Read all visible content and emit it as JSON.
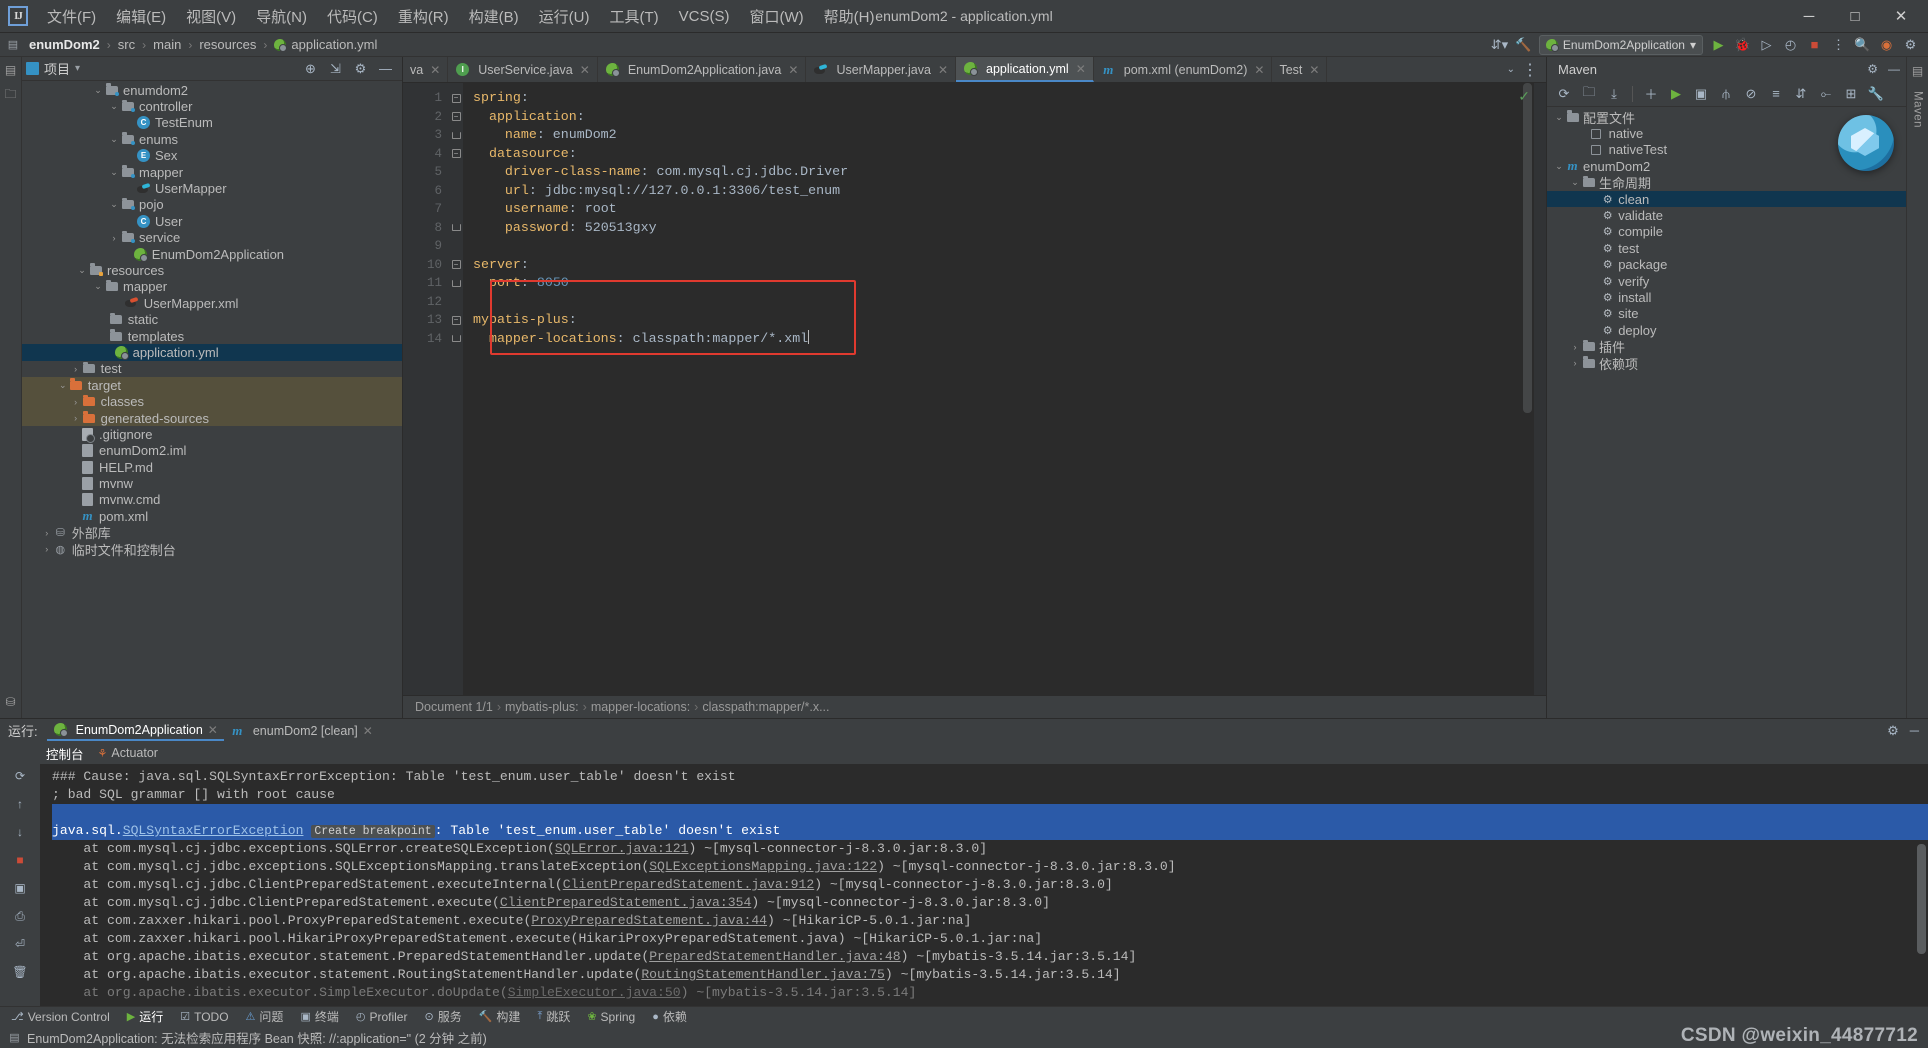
{
  "window": {
    "title": "enumDom2 - application.yml",
    "logo": "IJ",
    "controls": {
      "minimize": "─",
      "maximize": "□",
      "close": "✕"
    }
  },
  "menu": [
    {
      "label": "文件(F)",
      "name": "file"
    },
    {
      "label": "编辑(E)",
      "name": "edit"
    },
    {
      "label": "视图(V)",
      "name": "view"
    },
    {
      "label": "导航(N)",
      "name": "navigate"
    },
    {
      "label": "代码(C)",
      "name": "code"
    },
    {
      "label": "重构(R)",
      "name": "refactor"
    },
    {
      "label": "构建(B)",
      "name": "build"
    },
    {
      "label": "运行(U)",
      "name": "run"
    },
    {
      "label": "工具(T)",
      "name": "tools"
    },
    {
      "label": "VCS(S)",
      "name": "vcs"
    },
    {
      "label": "窗口(W)",
      "name": "window"
    },
    {
      "label": "帮助(H)",
      "name": "help"
    }
  ],
  "breadcrumb": {
    "items": [
      "enumDom2",
      "src",
      "main",
      "resources",
      "application.yml"
    ],
    "separator": "›"
  },
  "run_config": {
    "name": "EnumDom2Application",
    "chevron": "▾"
  },
  "project_panel": {
    "title": "项目",
    "dropdown": "▾",
    "tree": [
      {
        "indent": 4,
        "arrow": "⌄",
        "icon": "folder-src",
        "label": "enumdom2"
      },
      {
        "indent": 5,
        "arrow": "⌄",
        "icon": "folder-src",
        "label": "controller"
      },
      {
        "indent": 6,
        "arrow": "",
        "icon": "class",
        "label": "TestEnum"
      },
      {
        "indent": 5,
        "arrow": "⌄",
        "icon": "folder-src",
        "label": "enums"
      },
      {
        "indent": 6,
        "arrow": "",
        "icon": "enum",
        "label": "Sex"
      },
      {
        "indent": 5,
        "arrow": "⌄",
        "icon": "folder-src",
        "label": "mapper"
      },
      {
        "indent": 6,
        "arrow": "",
        "icon": "mybatis",
        "label": "UserMapper"
      },
      {
        "indent": 5,
        "arrow": "⌄",
        "icon": "folder-src",
        "label": "pojo"
      },
      {
        "indent": 6,
        "arrow": "",
        "icon": "class",
        "label": "User"
      },
      {
        "indent": 5,
        "arrow": "›",
        "icon": "folder-src",
        "label": "service"
      },
      {
        "indent": 5.8,
        "arrow": "",
        "icon": "spring",
        "label": "EnumDom2Application"
      },
      {
        "indent": 3,
        "arrow": "⌄",
        "icon": "folder-res",
        "label": "resources"
      },
      {
        "indent": 4,
        "arrow": "⌄",
        "icon": "folder",
        "label": "mapper"
      },
      {
        "indent": 5.3,
        "arrow": "",
        "icon": "mybatis-red",
        "label": "UserMapper.xml"
      },
      {
        "indent": 4.3,
        "arrow": "",
        "icon": "folder",
        "label": "static"
      },
      {
        "indent": 4.3,
        "arrow": "",
        "icon": "folder",
        "label": "templates"
      },
      {
        "indent": 4.6,
        "arrow": "",
        "icon": "spring",
        "label": "application.yml",
        "state": "selected"
      },
      {
        "indent": 2.6,
        "arrow": "›",
        "icon": "folder",
        "label": "test"
      },
      {
        "indent": 1.8,
        "arrow": "⌄",
        "icon": "folder-orange",
        "label": "target",
        "state": "target"
      },
      {
        "indent": 2.6,
        "arrow": "›",
        "icon": "folder-orange",
        "label": "classes",
        "state": "target"
      },
      {
        "indent": 2.6,
        "arrow": "›",
        "icon": "folder-orange",
        "label": "generated-sources",
        "state": "target"
      },
      {
        "indent": 2.5,
        "arrow": "",
        "icon": "gitignore",
        "label": ".gitignore"
      },
      {
        "indent": 2.5,
        "arrow": "",
        "icon": "file",
        "label": "enumDom2.iml"
      },
      {
        "indent": 2.5,
        "arrow": "",
        "icon": "file",
        "label": "HELP.md"
      },
      {
        "indent": 2.5,
        "arrow": "",
        "icon": "file",
        "label": "mvnw"
      },
      {
        "indent": 2.5,
        "arrow": "",
        "icon": "file",
        "label": "mvnw.cmd"
      },
      {
        "indent": 2.5,
        "arrow": "",
        "icon": "maven",
        "label": "pom.xml"
      },
      {
        "indent": 0.8,
        "arrow": "›",
        "icon": "lib",
        "label": "外部库"
      },
      {
        "indent": 0.8,
        "arrow": "›",
        "icon": "console",
        "label": "临时文件和控制台"
      }
    ]
  },
  "editor": {
    "tabs": [
      {
        "label": "va",
        "icon": "java",
        "active": false,
        "truncated": true
      },
      {
        "label": "UserService.java",
        "icon": "interface",
        "active": false
      },
      {
        "label": "EnumDom2Application.java",
        "icon": "spring",
        "active": false
      },
      {
        "label": "UserMapper.java",
        "icon": "mybatis",
        "active": false
      },
      {
        "label": "application.yml",
        "icon": "spring",
        "active": true
      },
      {
        "label": "pom.xml (enumDom2)",
        "icon": "maven",
        "active": false
      },
      {
        "label": "Test",
        "icon": "class",
        "active": false,
        "truncated": true
      }
    ],
    "tab_overflow": "⌄",
    "tab_more": "⋮",
    "inspection_ok": "✓",
    "line_numbers": [
      1,
      2,
      3,
      4,
      5,
      6,
      7,
      8,
      9,
      10,
      11,
      12,
      13,
      14
    ],
    "lines": [
      {
        "n": 1,
        "indent": 0,
        "key": "spring",
        "colon": ":",
        "value": "",
        "fold": "minus"
      },
      {
        "n": 2,
        "indent": 2,
        "key": "application",
        "colon": ":",
        "value": "",
        "fold": "minus"
      },
      {
        "n": 3,
        "indent": 4,
        "key": "name",
        "colon": ":",
        "value": " enumDom2",
        "fold": "end"
      },
      {
        "n": 4,
        "indent": 2,
        "key": "datasource",
        "colon": ":",
        "value": "",
        "fold": "minus"
      },
      {
        "n": 5,
        "indent": 4,
        "key": "driver-class-name",
        "colon": ":",
        "value": " com.mysql.cj.jdbc.Driver",
        "fold": ""
      },
      {
        "n": 6,
        "indent": 4,
        "key": "url",
        "colon": ":",
        "value": " jdbc:mysql://127.0.0.1:3306/test_enum",
        "fold": ""
      },
      {
        "n": 7,
        "indent": 4,
        "key": "username",
        "colon": ":",
        "value": " root",
        "fold": ""
      },
      {
        "n": 8,
        "indent": 4,
        "key": "password",
        "colon": ":",
        "value": " 520513gxy",
        "fold": "end"
      },
      {
        "n": 9,
        "indent": 0,
        "key": "",
        "colon": "",
        "value": "",
        "fold": ""
      },
      {
        "n": 10,
        "indent": 0,
        "key": "server",
        "colon": ":",
        "value": "",
        "fold": "minus"
      },
      {
        "n": 11,
        "indent": 2,
        "key": "port",
        "colon": ":",
        "value": " 8050",
        "fold": "end"
      },
      {
        "n": 12,
        "indent": 0,
        "key": "",
        "colon": "",
        "value": "",
        "fold": ""
      },
      {
        "n": 13,
        "indent": 0,
        "key": "mybatis-plus",
        "colon": ":",
        "value": "",
        "fold": "minus"
      },
      {
        "n": 14,
        "indent": 2,
        "key": "mapper-locations",
        "colon": ":",
        "value": " classpath:mapper/*.xml",
        "fold": "end",
        "cursor": true
      }
    ],
    "highlight_box": {
      "color": "#e03a2f"
    },
    "status_breadcrumb": {
      "document": "Document 1/1",
      "path": [
        "mybatis-plus:",
        "mapper-locations:",
        "classpath:mapper/*.x..."
      ],
      "separator": "›"
    }
  },
  "maven_panel": {
    "title": "Maven",
    "side_label": "Maven",
    "toolbar": [
      "⟳",
      "὜1",
      "⤓",
      "+",
      "▶",
      "▷",
      "≀",
      "⊘",
      "≡",
      "↓↑",
      "⋮⋮",
      "⌫",
      "⚙"
    ],
    "tree": [
      {
        "indent": 0,
        "arrow": "⌄",
        "icon": "profiles",
        "label": "配置文件"
      },
      {
        "indent": 1.6,
        "arrow": "",
        "icon": "checkbox",
        "label": "native"
      },
      {
        "indent": 1.6,
        "arrow": "",
        "icon": "checkbox",
        "label": "nativeTest"
      },
      {
        "indent": 0,
        "arrow": "⌄",
        "icon": "maven",
        "label": "enumDom2"
      },
      {
        "indent": 1,
        "arrow": "⌄",
        "icon": "lifecycle",
        "label": "生命周期"
      },
      {
        "indent": 2.2,
        "arrow": "",
        "icon": "gear",
        "label": "clean",
        "state": "selected"
      },
      {
        "indent": 2.2,
        "arrow": "",
        "icon": "gear",
        "label": "validate"
      },
      {
        "indent": 2.2,
        "arrow": "",
        "icon": "gear",
        "label": "compile"
      },
      {
        "indent": 2.2,
        "arrow": "",
        "icon": "gear",
        "label": "test"
      },
      {
        "indent": 2.2,
        "arrow": "",
        "icon": "gear",
        "label": "package"
      },
      {
        "indent": 2.2,
        "arrow": "",
        "icon": "gear",
        "label": "verify"
      },
      {
        "indent": 2.2,
        "arrow": "",
        "icon": "gear",
        "label": "install"
      },
      {
        "indent": 2.2,
        "arrow": "",
        "icon": "gear",
        "label": "site"
      },
      {
        "indent": 2.2,
        "arrow": "",
        "icon": "gear",
        "label": "deploy"
      },
      {
        "indent": 1,
        "arrow": "›",
        "icon": "plugins",
        "label": "插件"
      },
      {
        "indent": 1,
        "arrow": "›",
        "icon": "deps",
        "label": "依赖项"
      }
    ]
  },
  "run_panel": {
    "label": "运行:",
    "tabs": [
      {
        "label": "EnumDom2Application",
        "icon": "spring",
        "active": true,
        "close": "✕"
      },
      {
        "label": "enumDom2 [clean]",
        "icon": "maven",
        "active": false,
        "close": "✕"
      }
    ],
    "subtabs": [
      {
        "label": "控制台",
        "active": true
      },
      {
        "label": "Actuator",
        "active": false
      }
    ],
    "settings_icon": "⚙",
    "minimize_icon": "─",
    "console_lines": [
      {
        "type": "plain",
        "text": "### Cause: java.sql.SQLSyntaxErrorException: Table 'test_enum.user_table' doesn't exist"
      },
      {
        "type": "plain",
        "text": "; bad SQL grammar [] with root cause"
      },
      {
        "type": "selected-blank",
        "text": ""
      },
      {
        "type": "exception",
        "prefix": "java.sql.",
        "link": "SQLSyntaxErrorException",
        "badge": "Create breakpoint",
        "suffix": ": Table 'test_enum.user_table' doesn't exist"
      },
      {
        "type": "stack",
        "pre": "    at com.mysql.cj.jdbc.exceptions.SQLError.createSQLException(",
        "link": "SQLError.java:121",
        "post": ") ~[mysql-connector-j-8.3.0.jar:8.3.0]"
      },
      {
        "type": "stack",
        "pre": "    at com.mysql.cj.jdbc.exceptions.SQLExceptionsMapping.translateException(",
        "link": "SQLExceptionsMapping.java:122",
        "post": ") ~[mysql-connector-j-8.3.0.jar:8.3.0]"
      },
      {
        "type": "stack",
        "pre": "    at com.mysql.cj.jdbc.ClientPreparedStatement.executeInternal(",
        "link": "ClientPreparedStatement.java:912",
        "post": ") ~[mysql-connector-j-8.3.0.jar:8.3.0]"
      },
      {
        "type": "stack",
        "pre": "    at com.mysql.cj.jdbc.ClientPreparedStatement.execute(",
        "link": "ClientPreparedStatement.java:354",
        "post": ") ~[mysql-connector-j-8.3.0.jar:8.3.0]"
      },
      {
        "type": "stack",
        "pre": "    at com.zaxxer.hikari.pool.ProxyPreparedStatement.execute(",
        "link": "ProxyPreparedStatement.java:44",
        "post": ") ~[HikariCP-5.0.1.jar:na]"
      },
      {
        "type": "stack",
        "pre": "    at com.zaxxer.hikari.pool.HikariProxyPreparedStatement.execute(HikariProxyPreparedStatement.java) ~[HikariCP-5.0.1.jar:na]",
        "link": "",
        "post": ""
      },
      {
        "type": "stack",
        "pre": "    at org.apache.ibatis.executor.statement.PreparedStatementHandler.update(",
        "link": "PreparedStatementHandler.java:48",
        "post": ") ~[mybatis-3.5.14.jar:3.5.14]"
      },
      {
        "type": "stack",
        "pre": "    at org.apache.ibatis.executor.statement.RoutingStatementHandler.update(",
        "link": "RoutingStatementHandler.java:75",
        "post": ") ~[mybatis-3.5.14.jar:3.5.14]"
      },
      {
        "type": "stack-dim",
        "pre": "    at org.apache.ibatis.executor.SimpleExecutor.doUpdate(",
        "link": "SimpleExecutor.java:50",
        "post": ") ~[mybatis-3.5.14.jar:3.5.14]"
      }
    ]
  },
  "status_bar": {
    "items": [
      {
        "label": "Version Control",
        "icon": "vcs",
        "name": "version-control"
      },
      {
        "label": "运行",
        "icon": "run",
        "name": "run",
        "active": true
      },
      {
        "label": "TODO",
        "icon": "todo",
        "name": "todo"
      },
      {
        "label": "问题",
        "icon": "problems",
        "name": "problems"
      },
      {
        "label": "终端",
        "icon": "terminal",
        "name": "terminal"
      },
      {
        "label": "Profiler",
        "icon": "profiler",
        "name": "profiler"
      },
      {
        "label": "服务",
        "icon": "services",
        "name": "services"
      },
      {
        "label": "构建",
        "icon": "build",
        "name": "build"
      },
      {
        "label": "跳跃",
        "icon": "jump",
        "name": "jump"
      },
      {
        "label": "Spring",
        "icon": "spring",
        "name": "spring"
      },
      {
        "label": "依赖",
        "icon": "deps",
        "name": "dependencies"
      }
    ],
    "message": "EnumDom2Application: 无法检索应用程序 Bean 快照: //:application=\" (2 分钟 之前)",
    "watermark": "CSDN @weixin_44877712"
  }
}
